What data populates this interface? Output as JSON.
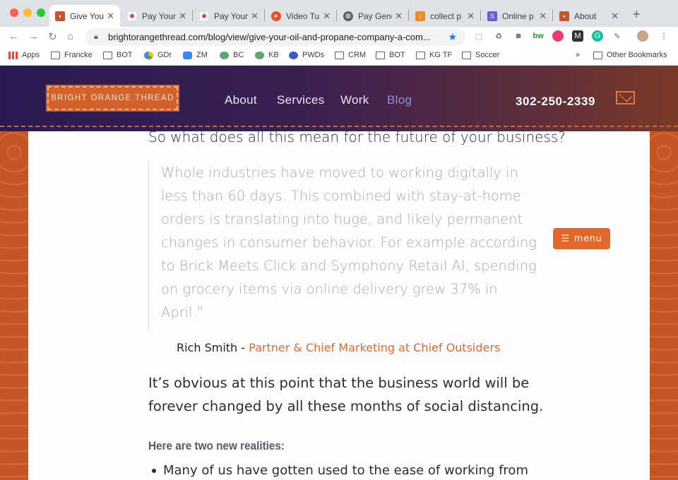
{
  "browser": {
    "tabs": [
      {
        "title": "Give Your",
        "active": true,
        "favicon": "bot-favicon"
      },
      {
        "title": "Pay Your",
        "active": false,
        "favicon": "lips-favicon"
      },
      {
        "title": "Pay Your",
        "active": false,
        "favicon": "lips-favicon"
      },
      {
        "title": "Video Tu",
        "active": false,
        "favicon": "video-favicon"
      },
      {
        "title": "Pay Gene",
        "active": false,
        "favicon": "globe-favicon"
      },
      {
        "title": "collect p",
        "active": false,
        "favicon": "collect-favicon"
      },
      {
        "title": "Online p",
        "active": false,
        "favicon": "s-favicon"
      },
      {
        "title": "About",
        "active": false,
        "favicon": "bot-favicon"
      }
    ],
    "new_tab": "+",
    "url": "brightorangethread.com/blog/view/give-your-oil-and-propane-company-a-com...",
    "bookmarks": [
      {
        "label": "Apps",
        "icon": "apps-grid-icon"
      },
      {
        "label": "Francke",
        "icon": "folder-icon"
      },
      {
        "label": "BOT",
        "icon": "folder-icon"
      },
      {
        "label": "GDr",
        "icon": "drive-icon"
      },
      {
        "label": "ZM",
        "icon": "zoom-icon"
      },
      {
        "label": "BC",
        "icon": "cloud-icon"
      },
      {
        "label": "KB",
        "icon": "cloud-icon"
      },
      {
        "label": "PWDs",
        "icon": "gear-icon"
      },
      {
        "label": "CRM",
        "icon": "folder-icon"
      },
      {
        "label": "BOT",
        "icon": "folder-icon"
      },
      {
        "label": "KG TF",
        "icon": "folder-icon"
      },
      {
        "label": "Soccer",
        "icon": "folder-icon"
      }
    ],
    "overflow": "»",
    "other_bookmarks": "Other Bookmarks"
  },
  "site": {
    "logo": "BRIGHT ORANGE THREAD",
    "nav": [
      {
        "label": "About",
        "active": false
      },
      {
        "label": "Services",
        "active": false
      },
      {
        "label": "Work",
        "active": false
      },
      {
        "label": "Blog",
        "active": true
      }
    ],
    "phone": "302-250-2339",
    "menu_button": "menu"
  },
  "article": {
    "cut_line": "So what does all this mean for the future of your business?",
    "quote_lines": [
      "Whole industries have moved to working digitally in",
      "less than 60 days. This combined with stay-at-home",
      "orders is translating into huge, and likely permanent",
      "changes in consumer behavior. For example according",
      "to Brick Meets Click and Symphony Retail AI, spending",
      "on grocery items via online delivery grew 37% in",
      "April.\""
    ],
    "attribution_name": "Rich Smith",
    "attribution_sep": " - ",
    "attribution_role": "Partner & Chief Marketing at Chief Outsiders",
    "para_lines": [
      "It’s obvious at this point that the business world will be",
      "forever changed by all these months of social distancing."
    ],
    "heading": "Here are two new realities:",
    "bullet": "Many of us have gotten used to the ease of working from"
  },
  "colors": {
    "accent": "#e3662a",
    "header_dark": "#2b1a52",
    "active_nav": "#8d8fd8"
  }
}
